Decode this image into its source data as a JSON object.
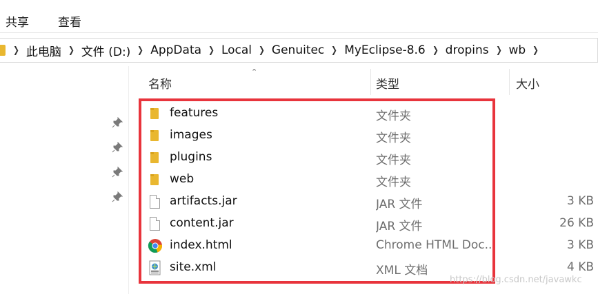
{
  "ribbon": {
    "tabs": [
      "共享",
      "查看"
    ]
  },
  "address": {
    "crumbs": [
      "此电脑",
      "文件 (D:)",
      "AppData",
      "Local",
      "Genuitec",
      "MyEclipse-8.6",
      "dropins",
      "wb"
    ]
  },
  "columns": {
    "name": "名称",
    "type": "类型",
    "size": "大小"
  },
  "files": [
    {
      "name": "features",
      "type": "文件夹",
      "size": "",
      "icon": "folder-icon"
    },
    {
      "name": "images",
      "type": "文件夹",
      "size": "",
      "icon": "folder-icon"
    },
    {
      "name": "plugins",
      "type": "文件夹",
      "size": "",
      "icon": "folder-icon"
    },
    {
      "name": "web",
      "type": "文件夹",
      "size": "",
      "icon": "folder-icon"
    },
    {
      "name": "artifacts.jar",
      "type": "JAR 文件",
      "size": "3 KB",
      "icon": "file-icon"
    },
    {
      "name": "content.jar",
      "type": "JAR 文件",
      "size": "26 KB",
      "icon": "file-icon"
    },
    {
      "name": "index.html",
      "type": "Chrome HTML Doc...",
      "size": "3 KB",
      "icon": "chrome-icon"
    },
    {
      "name": "site.xml",
      "type": "XML 文档",
      "size": "4 KB",
      "icon": "xml-file-icon"
    }
  ],
  "watermark": "https://blog.csdn.net/javawkc",
  "colors": {
    "highlight": "#e8343c",
    "folder": "#e9b730"
  }
}
